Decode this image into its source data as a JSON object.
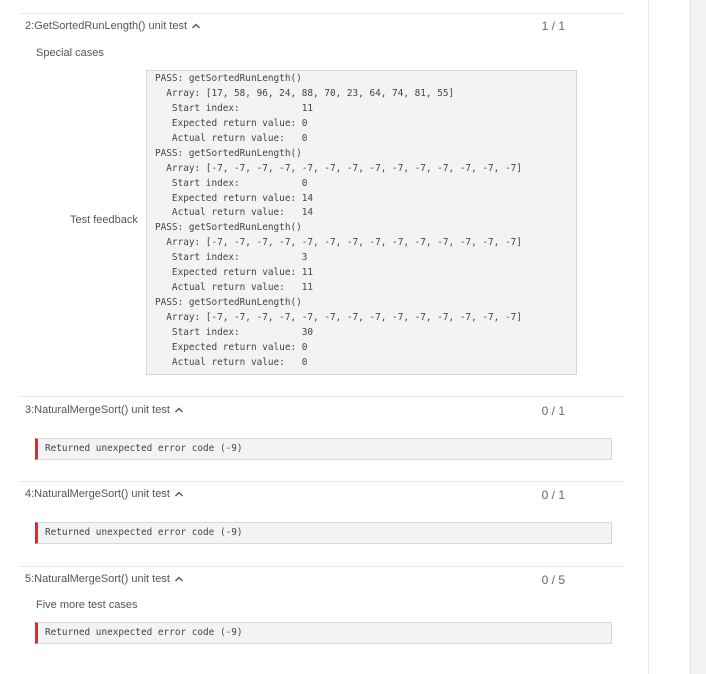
{
  "tests": [
    {
      "title": "2:GetSortedRunLength() unit test",
      "score": "1 / 1",
      "subtitle": "Special cases",
      "feedback_label": "Test feedback",
      "feedback_lines": [
        "PASS: getSortedRunLength()",
        "  Array: [17, 58, 96, 24, 88, 70, 23, 64, 74, 81, 55]",
        "   Start index:           11",
        "   Expected return value: 0",
        "   Actual return value:   0",
        "PASS: getSortedRunLength()",
        "  Array: [-7, -7, -7, -7, -7, -7, -7, -7, -7, -7, -7, -7, -7, -7]",
        "   Start index:           0",
        "   Expected return value: 14",
        "   Actual return value:   14",
        "PASS: getSortedRunLength()",
        "  Array: [-7, -7, -7, -7, -7, -7, -7, -7, -7, -7, -7, -7, -7, -7]",
        "   Start index:           3",
        "   Expected return value: 11",
        "   Actual return value:   11",
        "PASS: getSortedRunLength()",
        "  Array: [-7, -7, -7, -7, -7, -7, -7, -7, -7, -7, -7, -7, -7, -7]",
        "   Start index:           30",
        "   Expected return value: 0",
        "   Actual return value:   0"
      ]
    },
    {
      "title": "3:NaturalMergeSort() unit test",
      "score": "0 / 1",
      "error": "Returned unexpected error code (-9)"
    },
    {
      "title": "4:NaturalMergeSort() unit test",
      "score": "0 / 1",
      "error": "Returned unexpected error code (-9)"
    },
    {
      "title": "5:NaturalMergeSort() unit test",
      "score": "0 / 5",
      "subtitle": "Five more test cases",
      "error": "Returned unexpected error code (-9)"
    }
  ],
  "icons": {
    "collapse": "chevron-up-icon"
  },
  "colors": {
    "error_accent": "#d32f2f",
    "box_bg": "#f3f3f3"
  }
}
